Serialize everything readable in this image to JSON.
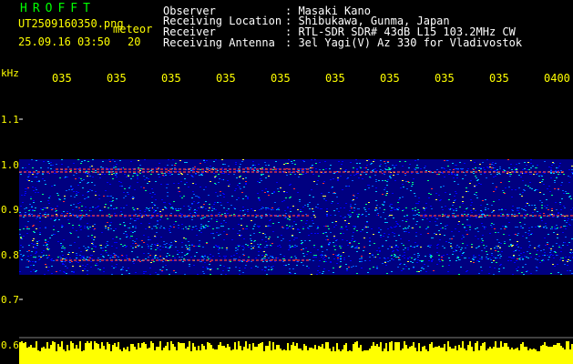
{
  "app": {
    "title": "HROFFT",
    "filename": "UT2509160350.png",
    "subtitle": "meteor",
    "datetime": "25.09.16 03:50",
    "timeframe": "20"
  },
  "header": {
    "rows": [
      {
        "label": "Observer",
        "value": ": Masaki Kano"
      },
      {
        "label": "Receiving Location",
        "value": ": Shibukawa, Gunma, Japan"
      },
      {
        "label": "Receiver",
        "value": ": RTL-SDR SDR# 43dB L15 103.2MHz CW"
      },
      {
        "label": "Receiving Antenna",
        "value": ": 3el Yagi(V) Az 330 for Vladivostok"
      }
    ]
  },
  "axis": {
    "unit": "kHz",
    "y_ticks": [
      "1.1",
      "1.0",
      "0.9",
      "0.8",
      "0.7",
      "0.6"
    ],
    "x_ticks": [
      "035",
      "035",
      "035",
      "035",
      "035",
      "035",
      "035",
      "035",
      "035",
      "0400"
    ]
  },
  "colors": {
    "yellow": "#ffff00",
    "green": "#00ff00",
    "background": "#000000",
    "deep_blue": "#000080"
  }
}
